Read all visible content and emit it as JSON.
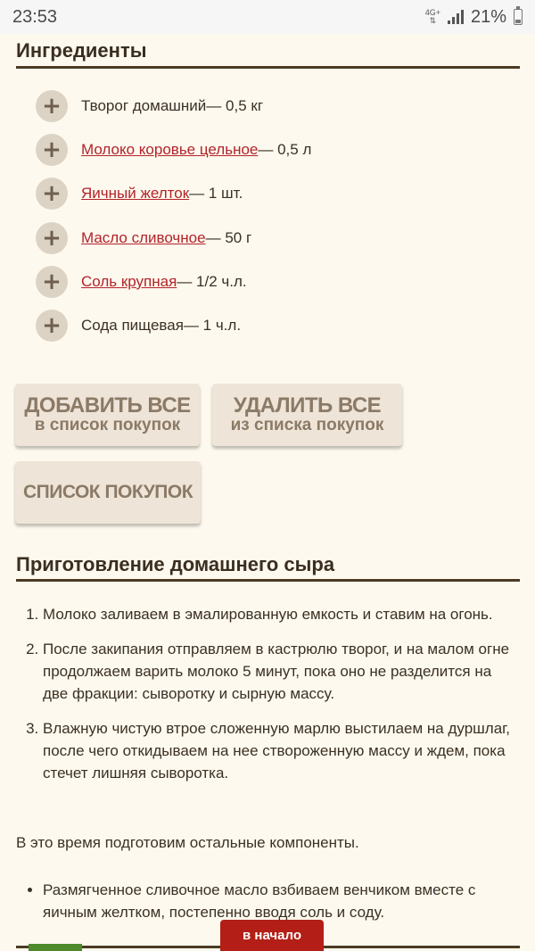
{
  "status_bar": {
    "time": "23:53",
    "network": "4G+",
    "battery": "21%"
  },
  "ingredients": {
    "title": "Ингредиенты",
    "items": [
      {
        "name": "Творог домашний",
        "amount": " — 0,5 кг"
      },
      {
        "name": "Молоко коровье цельное",
        "amount": " — 0,5 л"
      },
      {
        "name": "Яичный желток",
        "amount": " — 1 шт."
      },
      {
        "name": "Масло сливочное",
        "amount": " — 50 г"
      },
      {
        "name": "Соль крупная",
        "amount": " — 1/2 ч.л."
      },
      {
        "name": "Сода пищевая",
        "amount": " — 1 ч.л."
      }
    ]
  },
  "buttons": {
    "add_all_line1": "ДОБАВИТЬ ВСЕ",
    "add_all_line2": "в список покупок",
    "delete_all_line1": "УДАЛИТЬ ВСЕ",
    "delete_all_line2": "из списка покупок",
    "shopping_list": "СПИСОК ПОКУПОК"
  },
  "preparation": {
    "title": "Приготовление домашнего сыра",
    "steps": [
      "Молоко заливаем в эмалированную емкость и ставим на огонь.",
      "После закипания отправляем в кастрюлю творог, и на малом огне продолжаем варить молоко 5 минут, пока оно не разделится на две фракции: сыворотку и сырную массу.",
      "Влажную чистую втрое сложенную марлю выстилаем на дуршлаг, после чего откидываем на нее створоженную массу и ждем, пока стечет лишняя сыворотка."
    ],
    "paragraph": "В это время подготовим остальные компоненты.",
    "bullets": [
      "Размягченное сливочное масло взбиваем венчиком вместе с яичным желтком, постепенно вводя соль и соду."
    ]
  },
  "to_top_label": "в начало"
}
